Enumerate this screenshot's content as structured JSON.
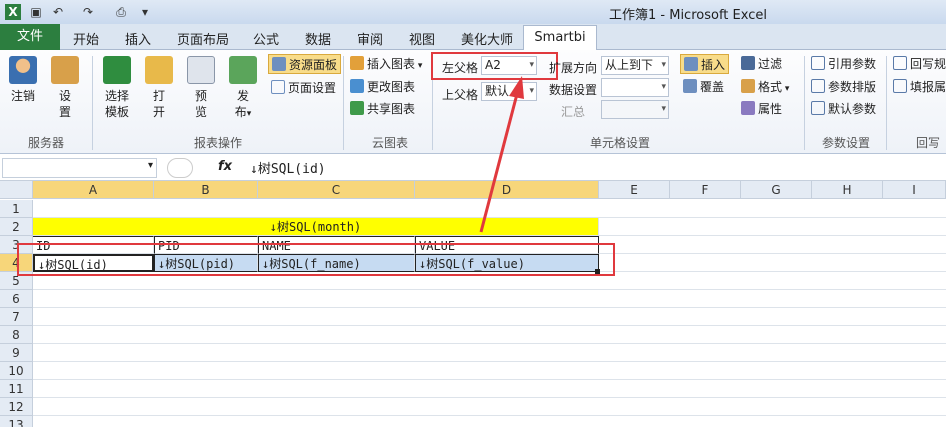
{
  "window": {
    "title": "工作簿1 - Microsoft Excel"
  },
  "tabs": [
    "文件",
    "开始",
    "插入",
    "页面布局",
    "公式",
    "数据",
    "审阅",
    "视图",
    "美化大师",
    "Smartbi"
  ],
  "ribbon": {
    "server": {
      "login": "注销",
      "settings_line1": "设",
      "settings_line2": "置",
      "group_label": "服务器"
    },
    "report_ops": {
      "select_template_line1": "选择",
      "select_template_line2": "模板",
      "open_line1": "打",
      "open_line2": "开",
      "preview_line1": "预",
      "preview_line2": "览",
      "publish_line1": "发",
      "publish_line2": "布",
      "resource_panel": "资源面板",
      "page_setup": "页面设置",
      "group_label": "报表操作"
    },
    "cloud_chart": {
      "insert_chart": "插入图表",
      "change_chart": "更改图表",
      "share_chart": "共享图表",
      "group_label": "云图表"
    },
    "cell_settings": {
      "left_parent_label": "左父格",
      "left_parent_value": "A2",
      "top_parent_label": "上父格",
      "top_parent_value": "默认",
      "expand_direction_label": "扩展方向",
      "expand_direction_value": "从上到下",
      "data_settings_label": "数据设置",
      "summary_label": "汇总",
      "insert": "插入",
      "overwrite": "覆盖",
      "filter": "过滤",
      "format": "格式",
      "property": "属性",
      "group_label": "单元格设置"
    },
    "params": {
      "reference_params": "引用参数",
      "param_layout": "参数排版",
      "default_params": "默认参数",
      "group_label": "参数设置"
    },
    "writeback": {
      "writeback_rule": "回写规",
      "fill_report": "填报属",
      "group_label": "回写"
    }
  },
  "formula_bar": {
    "fx": "fx",
    "content": "↓树SQL(id)"
  },
  "sheet": {
    "columns": [
      "A",
      "B",
      "C",
      "D",
      "E",
      "F",
      "G",
      "H",
      "I"
    ],
    "rows": [
      "1",
      "2",
      "3",
      "4",
      "5",
      "6",
      "7",
      "8",
      "9",
      "10",
      "11",
      "12",
      "13"
    ],
    "cells": {
      "C2": "↓树SQL(month)",
      "A3": "ID",
      "B3": "PID",
      "C3": "NAME",
      "D3": "VALUE",
      "A4": "↓树SQL(id)",
      "B4": "↓树SQL(pid)",
      "C4": "↓树SQL(f_name)",
      "D4": "↓树SQL(f_value)"
    },
    "colors": {
      "highlight_yellow": "#ffff00",
      "selected_blue": "#c6dbf2",
      "annotation_red": "#e0393e"
    }
  }
}
